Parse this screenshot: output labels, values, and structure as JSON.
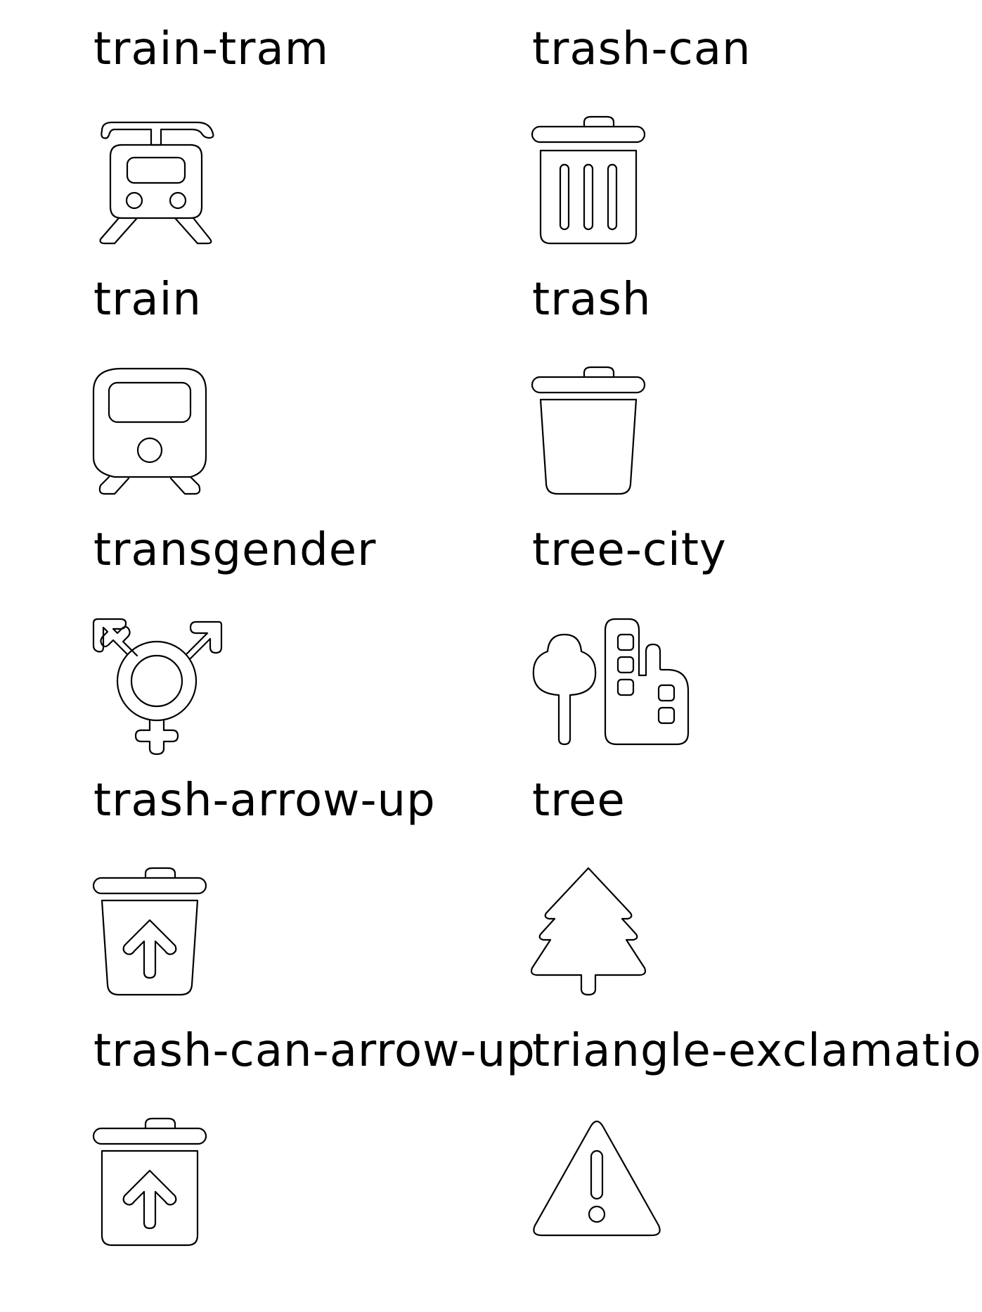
{
  "icons": [
    {
      "label": "train-tram",
      "icon": "train-tram-icon"
    },
    {
      "label": "trash-can",
      "icon": "trash-can-icon"
    },
    {
      "label": "train",
      "icon": "train-icon"
    },
    {
      "label": "trash",
      "icon": "trash-icon"
    },
    {
      "label": "transgender",
      "icon": "transgender-icon"
    },
    {
      "label": "tree-city",
      "icon": "tree-city-icon"
    },
    {
      "label": "trash-arrow-up",
      "icon": "trash-arrow-up-icon"
    },
    {
      "label": "tree",
      "icon": "tree-icon"
    },
    {
      "label": "trash-can-arrow-up",
      "icon": "trash-can-arrow-up-icon"
    },
    {
      "label": "triangle-exclamation",
      "icon": "triangle-exclamation-icon"
    }
  ],
  "colors": {
    "background": "#ffffff",
    "stroke": "#000000"
  }
}
